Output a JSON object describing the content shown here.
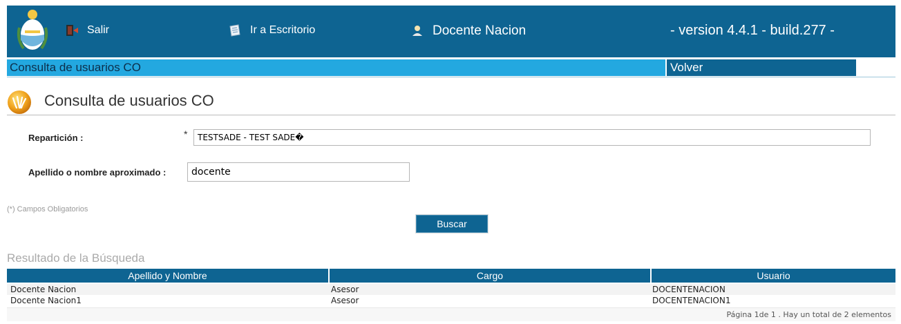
{
  "header": {
    "salir_label": "Salir",
    "escritorio_label": "Ir a Escritorio",
    "user_label": "Docente Nacion",
    "version_text": "- version 4.4.1 - build.277 -",
    "color": "#0e6492"
  },
  "subbar": {
    "title": "Consulta de usuarios CO",
    "volver_label": "Volver",
    "color": "#23a8e0"
  },
  "page": {
    "title": "Consulta de usuarios CO"
  },
  "form": {
    "reparticion_label": "Repartición :",
    "required_marker": "*",
    "reparticion_value": "TESTSADE - TEST SADE�",
    "apellido_label": "Apellido o nombre aproximado :",
    "apellido_value": "docente",
    "required_note": "(*) Campos Obligatorios",
    "search_button": "Buscar"
  },
  "results": {
    "title": "Resultado de la Búsqueda",
    "columns": [
      "Apellido y Nombre",
      "Cargo",
      "Usuario"
    ],
    "rows": [
      [
        "Docente Nacion",
        "Asesor",
        "DOCENTENACION"
      ],
      [
        "Docente Nacion1",
        "Asesor",
        "DOCENTENACION1"
      ]
    ],
    "pager_text": "Página 1de 1 . Hay un total de 2 elementos"
  },
  "icons": {
    "logo": "coat-of-arms-icon",
    "salir": "exit-door-icon",
    "escritorio": "desktop-shortcut-icon",
    "user": "user-icon",
    "page": "magnifier-badge-icon"
  }
}
